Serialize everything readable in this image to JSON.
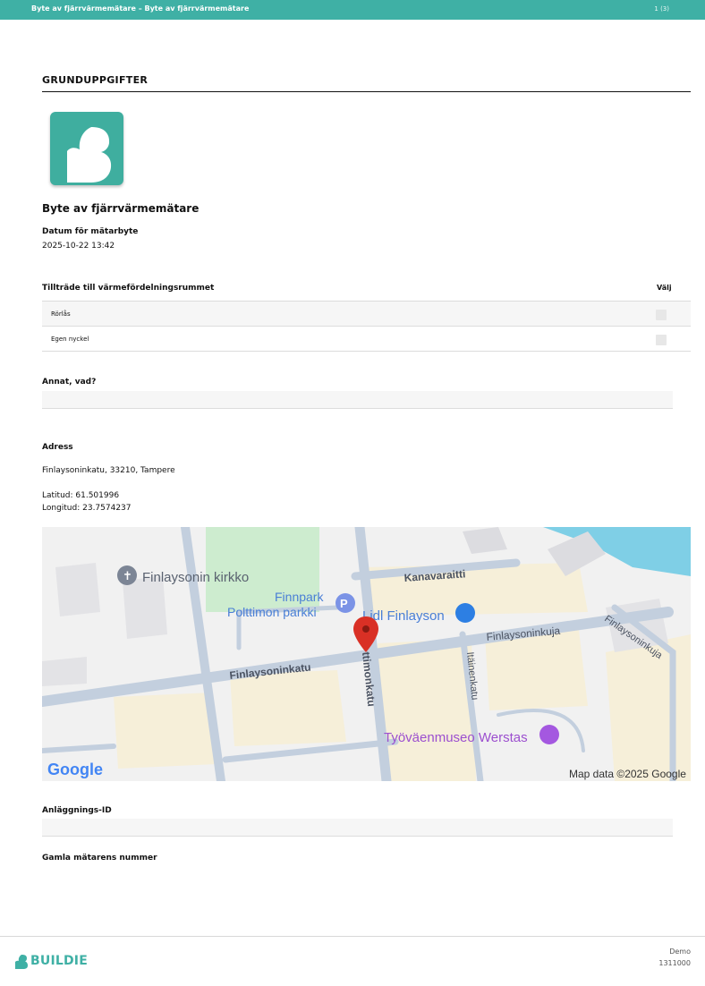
{
  "header": {
    "title": "Byte av fjärrvärmemätare – Byte av fjärrvärmemätare",
    "page": "1 (3)"
  },
  "section": {
    "title": "GRUNDUPPGIFTER"
  },
  "document": {
    "title": "Byte av fjärrvärmemätare",
    "date_label": "Datum för mätarbyte",
    "date_value": "2025-10-22 13:42"
  },
  "access_table": {
    "header_label": "Tillträde till värmefördelningsrummet",
    "header_choose": "Välj",
    "rows": [
      {
        "label": "Rörlås"
      },
      {
        "label": "Egen nyckel"
      }
    ]
  },
  "other": {
    "label": "Annat, vad?",
    "value": ""
  },
  "address": {
    "label": "Adress",
    "value": "Finlaysoninkatu, 33210, Tampere",
    "lat": "Latitud: 61.501996",
    "lon": "Longitud: 23.7574237"
  },
  "map": {
    "labels": {
      "church": "Finlaysonin kirkko",
      "parking1": "Finnpark",
      "parking2": "Polttimon parkki",
      "lidl": "Lidl Finlayson",
      "kanavaraitti": "Kanavaraitti",
      "finlaysoninkuja": "Finlaysoninkuja",
      "finlaysoninkuja2": "Finlaysoninkuja",
      "finlaysoninkatu": "Finlaysoninkatu",
      "polttimonkatu": "ttimonkatu",
      "itainenkatu": "Itäinenkatu",
      "museum": "Työväenmuseo Werstas",
      "copyright": "Map data ©2025 Google",
      "google": "Google"
    },
    "colors": {
      "road": "#c3cfde",
      "park": "#cdeccf",
      "water": "#7fcfe6",
      "building": "#f6efd9",
      "pin": "#d93025"
    }
  },
  "facility": {
    "label": "Anläggnings-ID",
    "value": ""
  },
  "old_meter": {
    "label": "Gamla mätarens nummer"
  },
  "footer": {
    "brand": "BUILDIE",
    "line1": "Demo",
    "line2": "1311000",
    "accent": "#3fb0a5"
  }
}
